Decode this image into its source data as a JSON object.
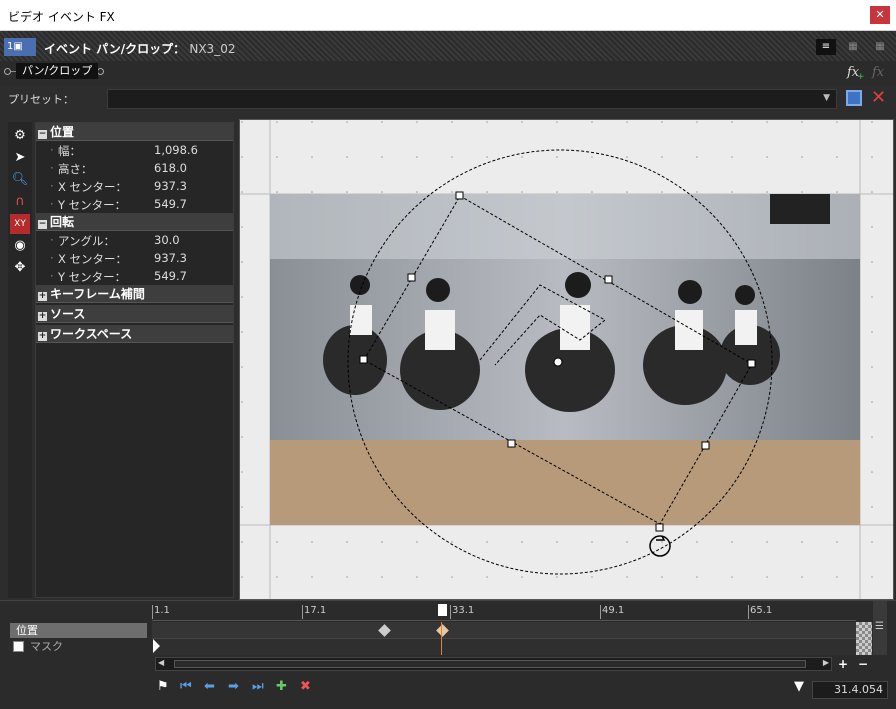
{
  "window": {
    "title": "ビデオ イベント FX",
    "close": "✕"
  },
  "header": {
    "badge": "1▣",
    "label": "イベント パン/クロップ：",
    "event": "NX3_02",
    "view_icons": [
      "≡",
      "▦",
      "▦",
      "▦"
    ]
  },
  "chain": {
    "plugin": "パン/クロップ",
    "fx_add": "fx",
    "fx_remove": "fx"
  },
  "preset": {
    "label": "プリセット：",
    "value": "",
    "arrow": "▼"
  },
  "tools": [
    "gear-icon",
    "pointer-icon",
    "zoom-icon",
    "magnet-icon",
    "lock-aspect-icon",
    "center-icon",
    "move-icon"
  ],
  "properties": {
    "position": {
      "title": "位置",
      "toggle": "−",
      "rows": [
        {
          "k": "幅：",
          "v": "1,098.6"
        },
        {
          "k": "高さ：",
          "v": "618.0"
        },
        {
          "k": "X センター：",
          "v": "937.3"
        },
        {
          "k": "Y センター：",
          "v": "549.7"
        }
      ]
    },
    "rotation": {
      "title": "回転",
      "toggle": "−",
      "rows": [
        {
          "k": "アングル：",
          "v": "30.0"
        },
        {
          "k": "X センター：",
          "v": "937.3"
        },
        {
          "k": "Y センター：",
          "v": "549.7"
        }
      ]
    },
    "collapsed": [
      {
        "title": "キーフレーム補間",
        "toggle": "+"
      },
      {
        "title": "ソース",
        "toggle": "+"
      },
      {
        "title": "ワークスペース",
        "toggle": "+"
      }
    ]
  },
  "timeline": {
    "ticks": [
      "1.1",
      "17.1",
      "33.1",
      "49.1",
      "65.1"
    ],
    "tracks": {
      "position": "位置",
      "mask": "マスク"
    },
    "current_time": "31.4.054",
    "zoom_in": "+",
    "zoom_out": "−",
    "buttons": [
      "◀",
      "▶"
    ]
  },
  "colors": {
    "accent": "#4a6fb0",
    "close": "#c8343c",
    "cursor": "#e08030"
  }
}
